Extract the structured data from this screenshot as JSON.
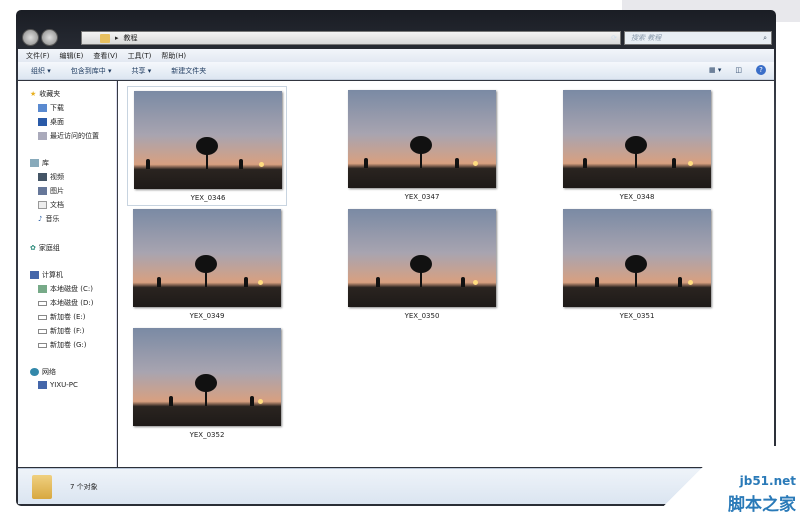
{
  "address": {
    "path": "教程",
    "search_placeholder": "搜索 教程"
  },
  "menu": [
    "文件(F)",
    "编辑(E)",
    "查看(V)",
    "工具(T)",
    "帮助(H)"
  ],
  "toolbar": {
    "organize": "组织 ▾",
    "include": "包含到库中 ▾",
    "share": "共享 ▾",
    "new_folder": "新建文件夹"
  },
  "sidebar": {
    "favorites": "收藏夹",
    "downloads": "下载",
    "desktop": "桌面",
    "recent": "最近访问的位置",
    "libraries": "库",
    "videos": "视频",
    "pictures": "图片",
    "documents": "文档",
    "music": "音乐",
    "homegroup": "家庭组",
    "computer": "计算机",
    "c": "本地磁盘 (C:)",
    "d": "本地磁盘 (D:)",
    "e": "新加卷 (E:)",
    "f": "新加卷 (F:)",
    "g": "新加卷 (G:)",
    "network": "网络",
    "pc": "YIXU-PC"
  },
  "files": [
    "YEX_0346",
    "YEX_0347",
    "YEX_0348",
    "YEX_0349",
    "YEX_0350",
    "YEX_0351",
    "YEX_0352"
  ],
  "status": "7 个对象",
  "watermark": {
    "site": "jb51.net",
    "name": "脚本之家"
  }
}
